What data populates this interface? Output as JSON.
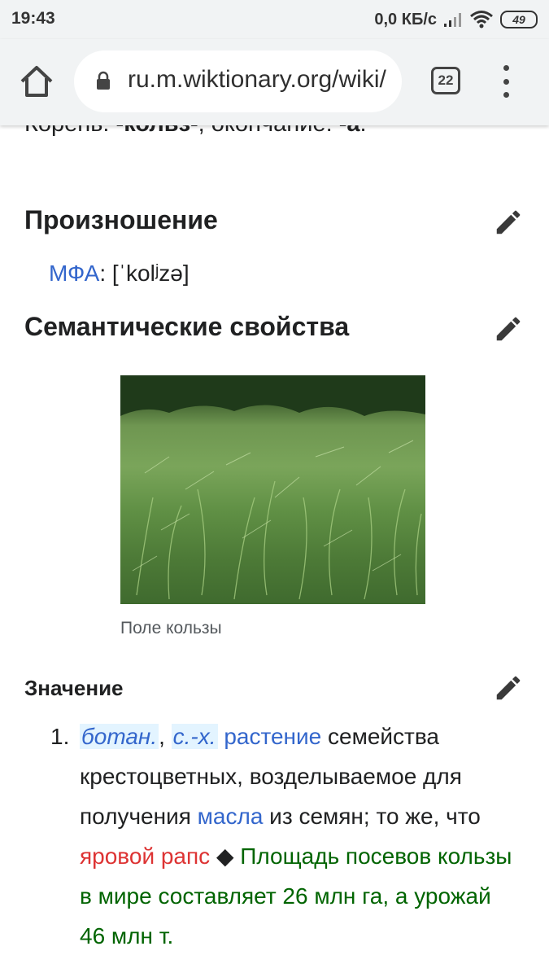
{
  "status_bar": {
    "time": "19:43",
    "net_speed": "0,0 КБ/с",
    "battery": "49"
  },
  "browser": {
    "url": "ru.m.wiktionary.org/wiki/",
    "tab_count": "22"
  },
  "article": {
    "morphology_line": {
      "prefix": "Корень: ",
      "root": "-кольз-",
      "middle": "; окончание: ",
      "ending": "-а",
      "suffix": "."
    },
    "pronunciation": {
      "heading": "Произношение",
      "ipa_label": "МФА",
      "ipa_value": ": [ˈkolʲzə]"
    },
    "semantics": {
      "heading": "Семантические свойства",
      "image_caption": "Поле кользы"
    },
    "meaning": {
      "heading": "Значение",
      "number": "1.",
      "label_1": "ботан.",
      "sep_1": ", ",
      "label_2": "с.-х.",
      "sep_2": " ",
      "link_plant": "растение",
      "text_1": " семейства крестоцветных, возделываемое для получения ",
      "link_oil": "масла",
      "text_2": " из семян; то же, что ",
      "link_rapeseed": "яровой рапс",
      "diamond": " ◆ ",
      "example": "Площадь посевов кользы в мире составляет 26 млн га, а урожай 46 млн т."
    }
  },
  "colors": {
    "link": "#3366cc",
    "redlink": "#dd3333",
    "example": "#006400",
    "toolbar_bg": "#f1f3f4"
  },
  "icons": [
    "wifi-icon",
    "signal-icon",
    "home-icon",
    "lock-icon",
    "tabs-icon",
    "more-vert-icon",
    "pencil-icon"
  ]
}
